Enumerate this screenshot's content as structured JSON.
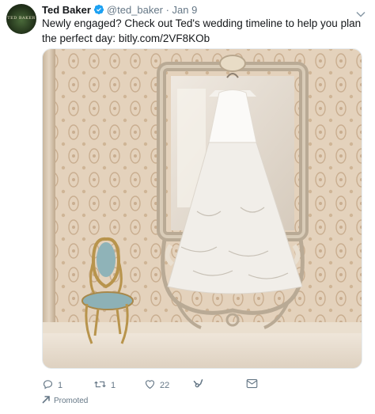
{
  "tweet": {
    "author_name": "Ted Baker",
    "handle": "@ted_baker",
    "separator": "·",
    "date": "Jan 9",
    "text": "Newly engaged? Check out Ted's wedding timeline to help you plan the perfect day: ",
    "link": "bitly.com/2VF8KOb",
    "verified_color": "#1da1f2"
  },
  "media": {
    "description": "white wedding gown hanging on an ornate mirror beside a blue velvet chair"
  },
  "actions": {
    "reply_count": "1",
    "retweet_count": "1",
    "like_count": "22"
  },
  "promoted_label": "Promoted",
  "icons": [
    "verified-badge-icon",
    "chevron-down-icon",
    "reply-icon",
    "retweet-icon",
    "like-icon",
    "analytics-icon",
    "direct-message-icon",
    "promoted-icon"
  ]
}
